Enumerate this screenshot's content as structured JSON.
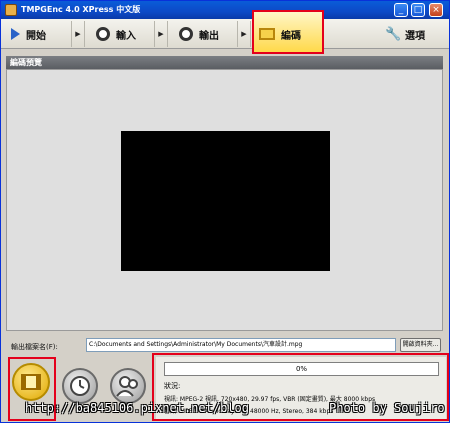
{
  "window": {
    "title": "TMPGEnc 4.0 XPress 中文版"
  },
  "toolbar": {
    "start": "開始",
    "input": "輸入",
    "output": "輸出",
    "encode": "編碼",
    "options": "選項",
    "arrow": "▶"
  },
  "panel": {
    "title": "編碼預覽"
  },
  "output": {
    "label": "輸出檔案名(F):",
    "path": "C:\\Documents and Settings\\Administrator\\My Documents\\汽車設計.mpg",
    "browse_button": "開啟資料夾..."
  },
  "status": {
    "progress": 0,
    "progress_text": "0%",
    "status_label": "狀況:",
    "video_line": "視訊:   MPEG-2 視訊, 720x480, 29.97 fps, VBR (固定畫質), 最大 8000 kbps",
    "audio_line": "音訊:   MPEG-1 Audio Layer II, 48000 Hz, Stereo, 384 kbps"
  },
  "watermark": {
    "left": "http://ba845106.pixnet.net/blog",
    "right": "Photo by Soujiro"
  },
  "colors": {
    "accent_red": "#e4001b",
    "titlebar": "#0c49c7",
    "encode_gold": "#e0a800"
  },
  "icons": [
    "play-icon",
    "film-reel-icon",
    "film-icon",
    "wrench-icon",
    "timer-icon",
    "users-icon"
  ]
}
